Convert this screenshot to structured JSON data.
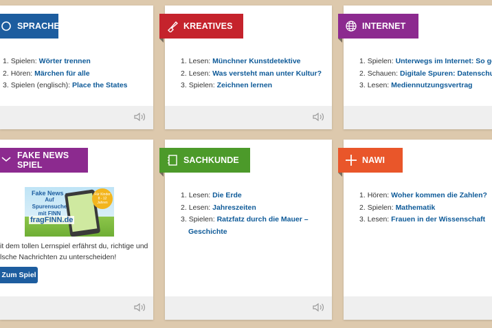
{
  "cards": {
    "sprache": {
      "title": "SPRACHE",
      "color": "#1d5d9f",
      "items": [
        {
          "num": "1.",
          "prefix": "Spielen: ",
          "link": "Wörter trennen"
        },
        {
          "num": "2.",
          "prefix": "Hören: ",
          "link": "Märchen für alle"
        },
        {
          "num": "3.",
          "prefix": "Spielen (englisch): ",
          "link": "Place the States"
        }
      ]
    },
    "kreatives": {
      "title": "KREATIVES",
      "color": "#c5232c",
      "items": [
        {
          "num": "1.",
          "prefix": "Lesen: ",
          "link": "Münchner Kunstdetektive"
        },
        {
          "num": "2.",
          "prefix": "Lesen: ",
          "link": "Was versteht man unter Kultur?"
        },
        {
          "num": "3.",
          "prefix": "Spielen: ",
          "link": "Zeichnen lernen"
        }
      ]
    },
    "internet": {
      "title": "INTERNET",
      "color": "#8c2a8f",
      "items": [
        {
          "num": "1.",
          "prefix": "Spielen: ",
          "link": "Unterwegs im Internet: So geht´s!"
        },
        {
          "num": "2.",
          "prefix": "Schauen: ",
          "link": "Digitale Spuren: Datenschutz"
        },
        {
          "num": "3.",
          "prefix": "Lesen: ",
          "link": "Mediennutzungsvertrag"
        }
      ]
    },
    "fakenews": {
      "title": "FAKE NEWS SPIEL",
      "color": "#8c2a8f",
      "image_text_1": "Fake News -",
      "image_text_2": "Auf Spurensuche",
      "image_text_3": "mit FINN",
      "image_brand": "fragFINN.de",
      "image_badge": "Für Kinder 8 - 12 Jahren",
      "text_line1": "it dem tollen Lernspiel erfährst du, richtige und",
      "text_line2": "lsche Nachrichten zu unterscheiden!",
      "button": "Zum Spiel"
    },
    "sachkunde": {
      "title": "SACHKUNDE",
      "color": "#4c9a2a",
      "items": [
        {
          "num": "1.",
          "prefix": "Lesen: ",
          "link": "Die Erde"
        },
        {
          "num": "2.",
          "prefix": "Lesen: ",
          "link": "Jahreszeiten"
        },
        {
          "num": "3.",
          "prefix": "Spielen: ",
          "link": "Ratzfatz durch die Mauer – Geschichte"
        }
      ]
    },
    "nawi": {
      "title": "NAWI",
      "color": "#e9562a",
      "items": [
        {
          "num": "1.",
          "prefix": "Hören: ",
          "link": "Woher kommen die Zahlen?"
        },
        {
          "num": "2.",
          "prefix": "Spielen: ",
          "link": "Mathematik"
        },
        {
          "num": "3.",
          "prefix": "Lesen: ",
          "link": "Frauen in der Wissenschaft"
        }
      ]
    }
  },
  "icons": {
    "speaker": "speaker-icon",
    "globe": "globe-icon",
    "palette": "paintbrush-icon",
    "book": "notebook-icon",
    "plus": "plus-icon",
    "chat": "speech-bubble-icon"
  }
}
